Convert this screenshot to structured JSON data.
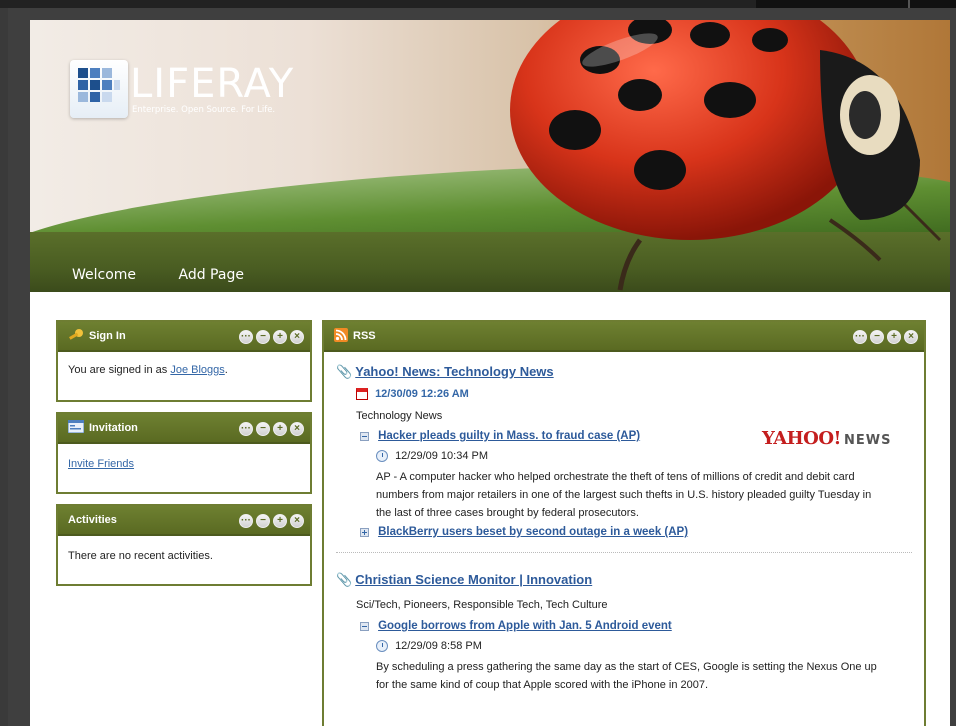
{
  "brand": {
    "name": "LIFERAY",
    "tagline": "Enterprise. Open Source. For Life."
  },
  "nav": {
    "items": [
      {
        "label": "Welcome"
      },
      {
        "label": "Add Page"
      }
    ]
  },
  "sign_in": {
    "title": "Sign In",
    "text_prefix": "You are signed in as ",
    "user_link": "Joe Bloggs",
    "text_suffix": "."
  },
  "invitation": {
    "title": "Invitation",
    "link": "Invite Friends"
  },
  "activities": {
    "title": "Activities",
    "empty": "There are no recent activities."
  },
  "rss": {
    "title": "RSS",
    "feeds": [
      {
        "title": "Yahoo! News: Technology News",
        "date": "12/30/09 12:26 AM",
        "category": "Technology News",
        "logo": {
          "main": "YAHOO!",
          "sub": "NEWS"
        },
        "items": [
          {
            "title": "Hacker pleads guilty in Mass. to fraud case (AP)",
            "date": "12/29/09 10:34 PM",
            "desc_lines": [
              "AP - A computer hacker who helped orchestrate the theft of tens of millions of credit and debit card",
              "numbers from major retailers in one of the largest such thefts in U.S. history pleaded guilty Tuesday in",
              "the last of three cases brought by federal prosecutors."
            ]
          },
          {
            "title": "BlackBerry users beset by second outage in a week (AP)"
          }
        ]
      },
      {
        "title": "Christian Science Monitor | Innovation",
        "category": "Sci/Tech, Pioneers, Responsible Tech, Tech Culture",
        "items": [
          {
            "title": "Google borrows from Apple with Jan. 5 Android event",
            "date": "12/29/09 8:58 PM",
            "desc_lines": [
              "By scheduling a press gathering the same day as the start of CES, Google is setting the Nexus One up",
              "for the same kind of coup that Apple scored with the iPhone in 2007."
            ]
          }
        ]
      }
    ]
  },
  "controls": {
    "config": "···",
    "minimize": "−",
    "maximize": "+",
    "close": "×"
  },
  "colors": {
    "portlet_header": "#5a6a22",
    "link": "#3467a7",
    "nav_band": "#4a5d22"
  }
}
